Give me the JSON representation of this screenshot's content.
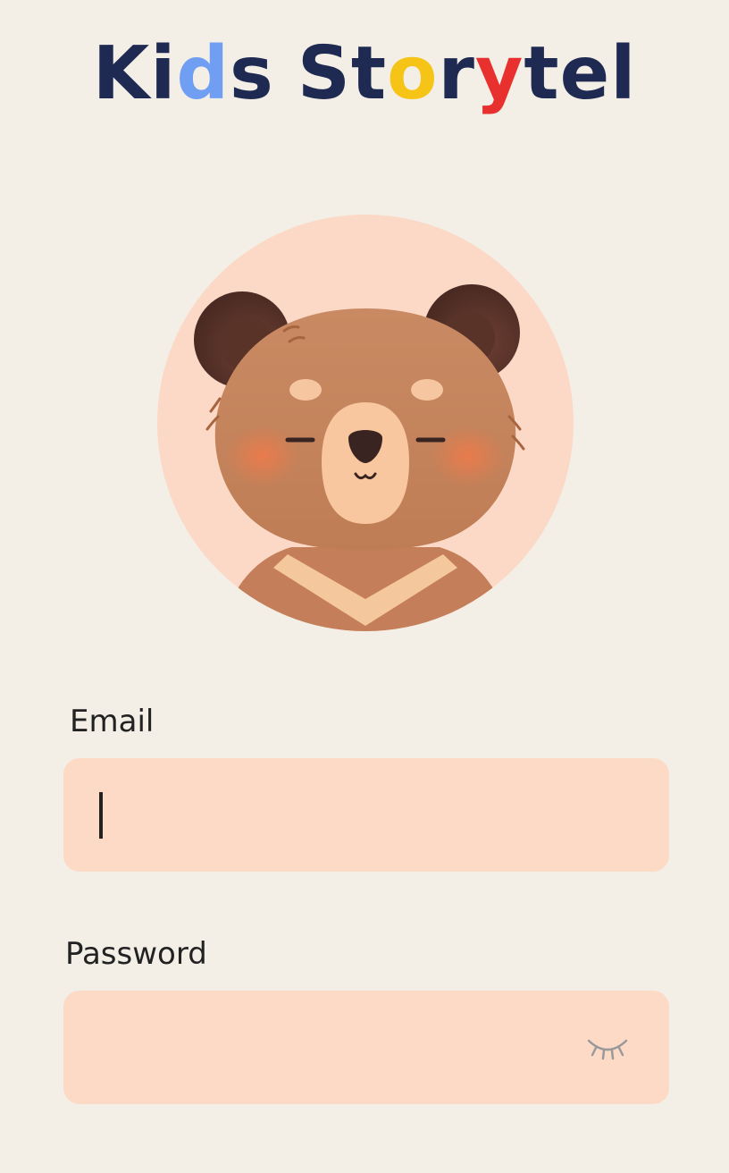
{
  "app": {
    "logo": {
      "text_parts": [
        {
          "text": "K",
          "color": "#1f2a52"
        },
        {
          "text": "i",
          "color": "#1f2a52"
        },
        {
          "text": "d",
          "color": "#6f9ef2"
        },
        {
          "text": "s",
          "color": "#1f2a52"
        },
        {
          "text": "S",
          "color": "#1f2a52"
        },
        {
          "text": "t",
          "color": "#1f2a52"
        },
        {
          "text": "o",
          "color": "#f6c416"
        },
        {
          "text": "r",
          "color": "#1f2a52"
        },
        {
          "text": "y",
          "color": "#e8302e"
        },
        {
          "text": "t",
          "color": "#1f2a52"
        },
        {
          "text": "e",
          "color": "#1f2a52"
        },
        {
          "text": "l",
          "color": "#1f2a52"
        }
      ],
      "word_break_after_index": 3
    }
  },
  "avatar": {
    "icon": "bear-avatar",
    "background_color": "#fbd9c6"
  },
  "form": {
    "email": {
      "label": "Email",
      "value": "",
      "placeholder": ""
    },
    "password": {
      "label": "Password",
      "value": "",
      "placeholder": "",
      "toggle_icon": "eye-closed-icon"
    }
  },
  "colors": {
    "background": "#f3efe6",
    "field_background": "#fcdac6",
    "label_text": "#222222",
    "brand_navy": "#1f2a52"
  }
}
